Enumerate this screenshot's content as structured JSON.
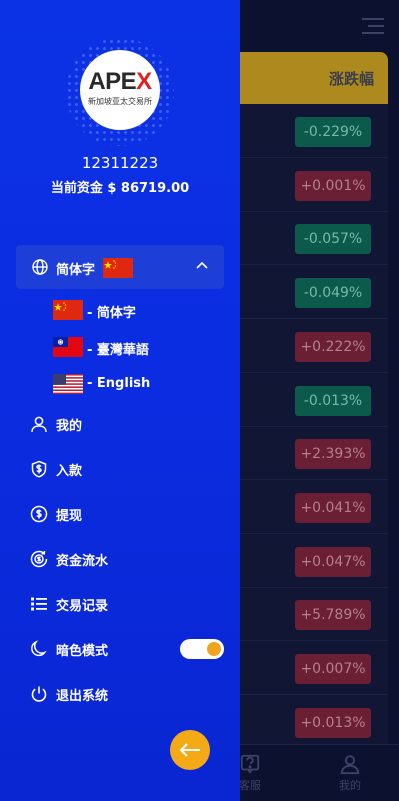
{
  "background": {
    "column_header": "涨跌幅",
    "changes": [
      {
        "value": "-0.229%",
        "dir": "down"
      },
      {
        "value": "+0.001%",
        "dir": "up"
      },
      {
        "value": "-0.057%",
        "dir": "down"
      },
      {
        "value": "-0.049%",
        "dir": "down"
      },
      {
        "value": "+0.222%",
        "dir": "up"
      },
      {
        "value": "-0.013%",
        "dir": "down"
      },
      {
        "value": "+2.393%",
        "dir": "up"
      },
      {
        "value": "+0.041%",
        "dir": "up"
      },
      {
        "value": "+0.047%",
        "dir": "up"
      },
      {
        "value": "+5.789%",
        "dir": "up"
      },
      {
        "value": "+0.007%",
        "dir": "up"
      },
      {
        "value": "+0.013%",
        "dir": "up"
      }
    ],
    "tabs": {
      "service": "客服",
      "mine": "我的"
    }
  },
  "drawer": {
    "logo": {
      "brand_a": "APE",
      "brand_x": "X",
      "subtitle": "新加坡亚太交易所"
    },
    "user_id": "12311223",
    "balance": "当前资金 $ 86719.00",
    "language": {
      "current": "简体字",
      "expanded": true,
      "options": [
        {
          "label": "- 简体字",
          "flag": "china-flag"
        },
        {
          "label": "- 臺灣華語",
          "flag": "taiwan-flag"
        },
        {
          "label": "- English",
          "flag": "usa-flag"
        }
      ]
    },
    "nav": [
      {
        "label": "我的",
        "icon": "user-icon"
      },
      {
        "label": "入款",
        "icon": "shield-dollar-icon"
      },
      {
        "label": "提现",
        "icon": "dollar-circle-icon"
      },
      {
        "label": "资金流水",
        "icon": "money-flow-icon"
      },
      {
        "label": "交易记录",
        "icon": "list-icon"
      },
      {
        "label": "暗色模式",
        "icon": "moon-icon"
      },
      {
        "label": "退出系统",
        "icon": "power-icon"
      }
    ],
    "dark_mode_on": true
  },
  "colors": {
    "drawer": "#0b2ce0",
    "accent": "#f3aa15",
    "down": "#0b5a4c",
    "up": "#6a1f34"
  }
}
